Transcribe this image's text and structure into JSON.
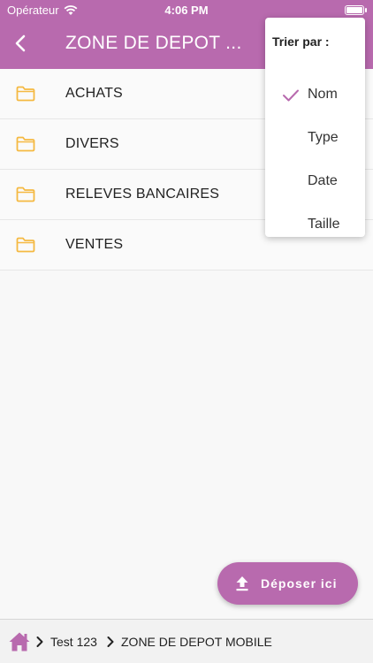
{
  "status_bar": {
    "carrier": "Opérateur",
    "time": "4:06 PM"
  },
  "header": {
    "title": "ZONE DE DEPOT ...",
    "back_icon": "chevron-left-icon"
  },
  "folders": [
    {
      "label": "ACHATS",
      "icon": "folder-icon"
    },
    {
      "label": "DIVERS",
      "icon": "folder-icon"
    },
    {
      "label": "RELEVES BANCAIRES",
      "icon": "folder-icon"
    },
    {
      "label": "VENTES",
      "icon": "folder-icon"
    }
  ],
  "sort_menu": {
    "title": "Trier par :",
    "options": [
      {
        "label": "Nom",
        "selected": true
      },
      {
        "label": "Type",
        "selected": false
      },
      {
        "label": "Date",
        "selected": false
      },
      {
        "label": "Taille",
        "selected": false
      }
    ]
  },
  "upload_button": {
    "label": "Déposer ici",
    "icon": "upload-icon"
  },
  "breadcrumb": {
    "items": [
      "Test 123",
      "ZONE DE DEPOT MOBILE"
    ]
  },
  "colors": {
    "accent": "#b86aae",
    "folder": "#f5b942"
  }
}
